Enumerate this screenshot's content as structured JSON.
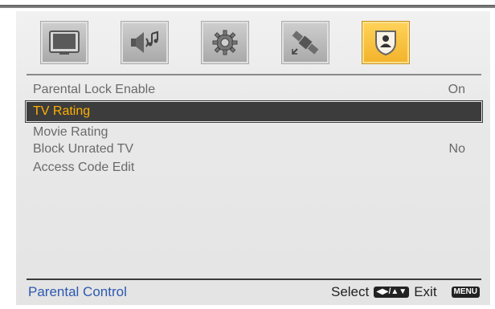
{
  "menu_tabs": [
    {
      "icon": "tv-picture-icon",
      "active": false
    },
    {
      "icon": "sound-icon",
      "active": false
    },
    {
      "icon": "gear-icon",
      "active": false
    },
    {
      "icon": "satellite-icon",
      "active": false
    },
    {
      "icon": "parental-lock-icon",
      "active": true
    }
  ],
  "items": [
    {
      "label": "Parental Lock Enable",
      "value": "On"
    },
    {
      "label": "TV Rating",
      "value": "",
      "selected": true
    },
    {
      "label": "Movie Rating",
      "value": ""
    },
    {
      "label": "Block Unrated TV",
      "value": "No"
    },
    {
      "label": "Access Code Edit",
      "value": ""
    }
  ],
  "footer": {
    "title": "Parental Control",
    "select_label": "Select",
    "select_keycap": "◀▶/▲▼",
    "exit_label": "Exit",
    "menu_keycap": "MENU"
  },
  "colors": {
    "selected_text": "#ffb000",
    "selected_bg": "#3c3c3c",
    "active_tab": "#f5b52f",
    "footer_title": "#2c58b0"
  }
}
